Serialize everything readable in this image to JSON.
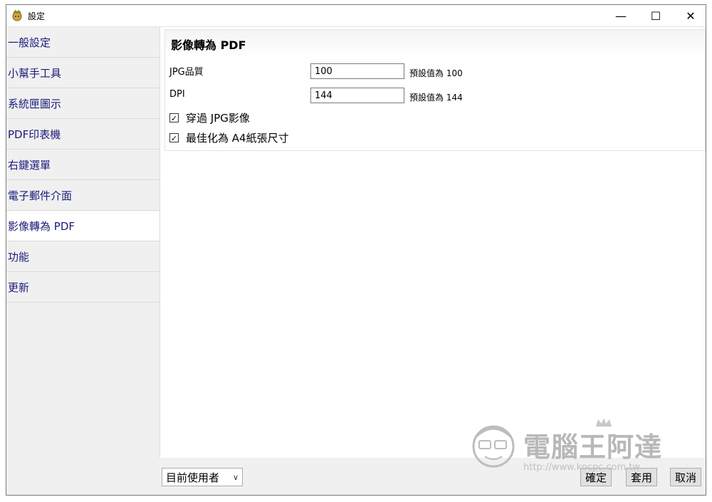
{
  "window": {
    "title": "設定",
    "controls": {
      "minimize": "—",
      "maximize": "☐",
      "close": "✕"
    }
  },
  "sidebar": {
    "items": [
      {
        "label": "一般設定"
      },
      {
        "label": "小幫手工具"
      },
      {
        "label": "系統匣圖示"
      },
      {
        "label": "PDF印表機"
      },
      {
        "label": "右鍵選單"
      },
      {
        "label": "電子郵件介面"
      },
      {
        "label": "影像轉為 PDF",
        "active": true
      },
      {
        "label": "功能"
      },
      {
        "label": "更新"
      }
    ]
  },
  "panel": {
    "title": "影像轉為 PDF",
    "jpg_quality": {
      "label": "JPG品質",
      "value": "100",
      "hint": "預設值為 100"
    },
    "dpi": {
      "label": "DPI",
      "value": "144",
      "hint": "預設值為 144"
    },
    "options": [
      {
        "label": "穿過 JPG影像",
        "checked": true
      },
      {
        "label": "最佳化為 A4紙張尺寸",
        "checked": true
      }
    ]
  },
  "footer": {
    "user_scope": "目前使用者",
    "ok_label": "確定",
    "apply_label": "套用",
    "cancel_label": "取消"
  },
  "watermark": {
    "name": "電腦王阿達",
    "url": "http://www.kocpc.com.tw"
  },
  "colors": {
    "nav_text": "#1a1a7a",
    "window_bg": "#f0f0f0",
    "active_item": "#ffffff"
  }
}
